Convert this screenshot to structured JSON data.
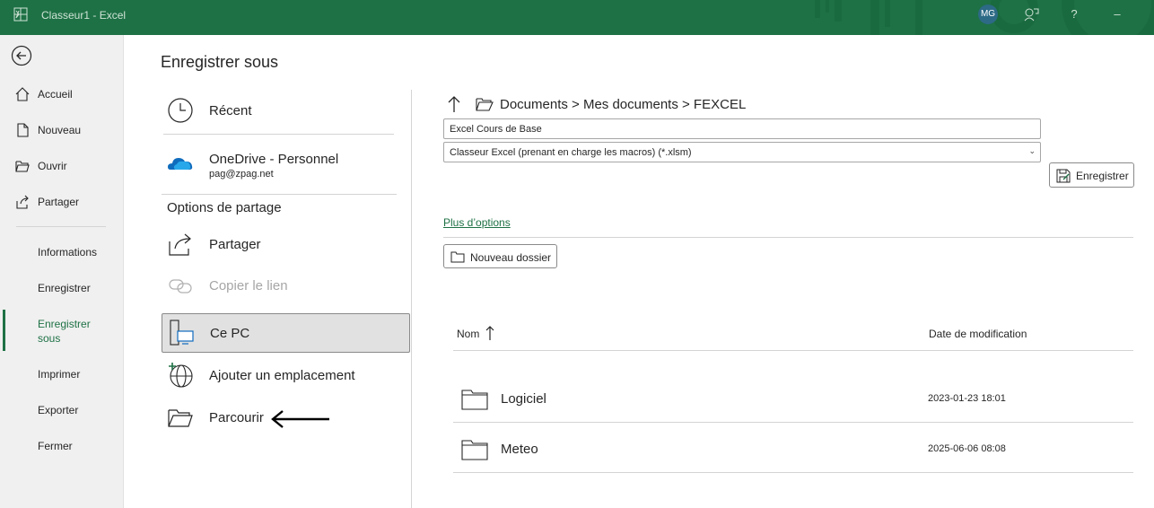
{
  "titlebar": {
    "title": "Classeur1  -  Excel",
    "avatar_initials": "MG",
    "help_label": "?",
    "minimize_label": "–"
  },
  "nav": {
    "items": [
      {
        "label": "Accueil",
        "icon": "home-icon"
      },
      {
        "label": "Nouveau",
        "icon": "new-document-icon"
      },
      {
        "label": "Ouvrir",
        "icon": "open-folder-icon"
      },
      {
        "label": "Partager",
        "icon": "share-icon"
      }
    ],
    "text_items": [
      {
        "label": "Informations"
      },
      {
        "label": "Enregistrer"
      },
      {
        "label": "Enregistrer sous",
        "active": true
      },
      {
        "label": "Imprimer"
      },
      {
        "label": "Exporter"
      },
      {
        "label": "Fermer"
      }
    ]
  },
  "page": {
    "title": "Enregistrer sous"
  },
  "locations": {
    "recent": "Récent",
    "onedrive_name": "OneDrive - Personnel",
    "onedrive_account": "pag@zpag.net",
    "share_options_heading": "Options de partage",
    "share": "Partager",
    "copy_link": "Copier le lien",
    "this_pc": "Ce PC",
    "add_location": "Ajouter un emplacement",
    "browse": "Parcourir"
  },
  "save_panel": {
    "path": "Documents > Mes documents > FEXCEL",
    "filename": "Excel Cours de Base",
    "filetype": "Classeur Excel (prenant en charge les macros) (*.xlsm)",
    "save_button": "Enregistrer",
    "more_options": "Plus d’options",
    "new_folder_button": "Nouveau dossier"
  },
  "file_list": {
    "col_name": "Nom",
    "col_date": "Date de modification",
    "rows": [
      {
        "name": "Logiciel",
        "date": "2023-01-23 18:01"
      },
      {
        "name": "Meteo",
        "date": "2025-06-06 08:08"
      }
    ]
  },
  "colors": {
    "accent": "#1e7145",
    "nav_bg": "#f0f0f0",
    "selected_bg": "#e1e1e1"
  }
}
